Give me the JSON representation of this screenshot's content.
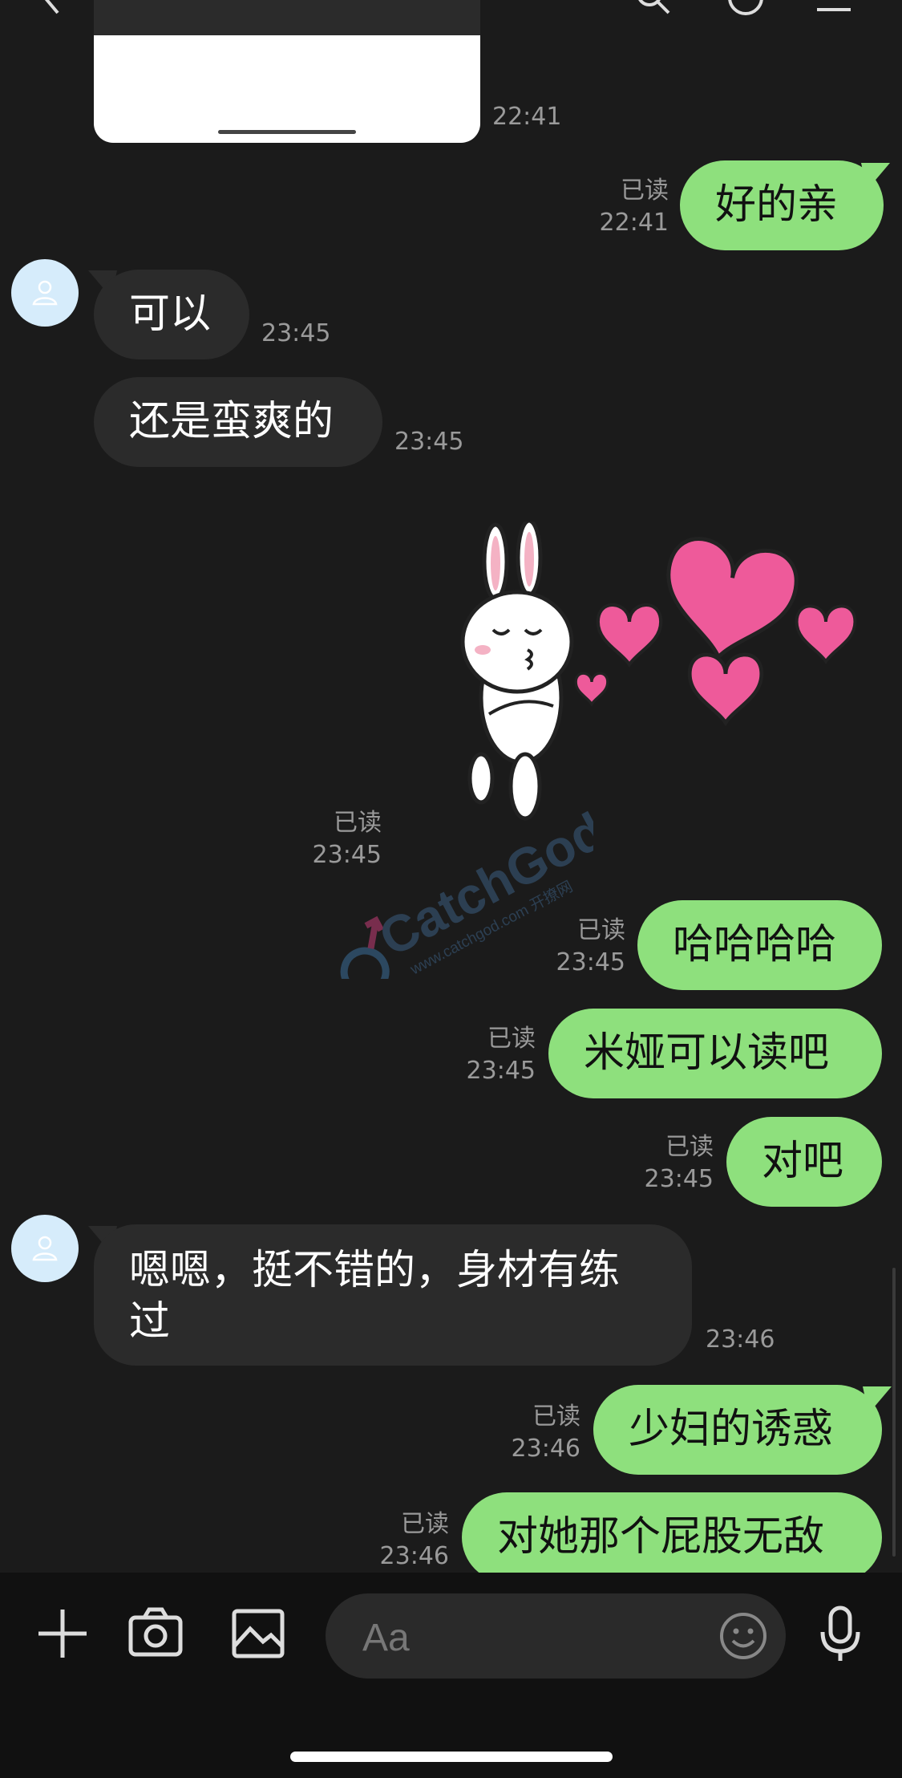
{
  "colors": {
    "bg": "#1b1b1b",
    "incoming": "#2b2b2b",
    "outgoing": "#8ee07d",
    "meta": "#9a9a9a"
  },
  "image_message": {
    "time": "22:41"
  },
  "messages": [
    {
      "dir": "out",
      "text": "好的亲",
      "read": "已读",
      "time": "22:41"
    },
    {
      "dir": "in",
      "text": "可以",
      "time": "23:45"
    },
    {
      "dir": "in",
      "text": "还是蛮爽的",
      "time": "23:45"
    },
    {
      "dir": "out",
      "type": "sticker",
      "read": "已读",
      "time": "23:45"
    },
    {
      "dir": "out",
      "text": "哈哈哈哈",
      "read": "已读",
      "time": "23:45"
    },
    {
      "dir": "out",
      "text": "米娅可以读吧",
      "read": "已读",
      "time": "23:45"
    },
    {
      "dir": "out",
      "text": "对吧",
      "read": "已读",
      "time": "23:45"
    },
    {
      "dir": "in",
      "text": "嗯嗯，挺不错的，身材有练过",
      "time": "23:46"
    },
    {
      "dir": "out",
      "text": "少妇的诱惑",
      "read": "已读",
      "time": "23:46"
    },
    {
      "dir": "out",
      "text": "对她那个屁股无敌",
      "read": "已读",
      "time": "23:46"
    }
  ],
  "watermark": {
    "brand": "CatchGod",
    "url": "www.catchgod.com 开撩网"
  },
  "composer": {
    "placeholder": "Aa",
    "icons": [
      "plus-icon",
      "camera-icon",
      "image-icon",
      "emoji-icon",
      "microphone-icon"
    ]
  }
}
